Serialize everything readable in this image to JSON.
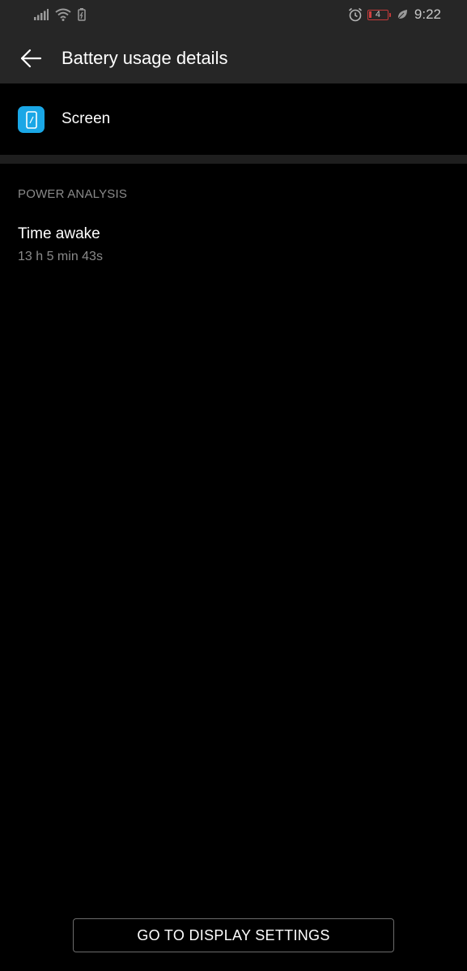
{
  "status_bar": {
    "battery_level": "4",
    "time": "9:22",
    "icons": [
      "signal-icon",
      "wifi-icon",
      "battery-saver-icon",
      "alarm-icon",
      "battery-icon",
      "eco-leaf-icon"
    ],
    "battery_color": "#c33a3a"
  },
  "app_bar": {
    "title": "Battery usage details",
    "back_icon": "back-arrow-icon"
  },
  "item": {
    "label": "Screen",
    "icon": "screen-app-icon",
    "icon_color": "#1aa7e6"
  },
  "power_analysis": {
    "header": "POWER ANALYSIS",
    "stats": [
      {
        "title": "Time awake",
        "value": "13 h 5 min 43s"
      }
    ]
  },
  "footer": {
    "button_label": "GO TO DISPLAY SETTINGS"
  }
}
